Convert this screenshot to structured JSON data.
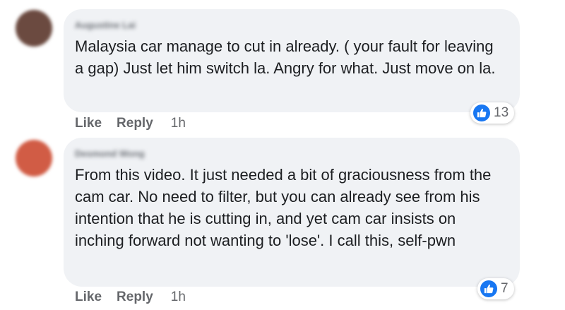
{
  "comments": [
    {
      "author": "Augustine Lai",
      "avatar_color": "#6b4a40",
      "text": "Malaysia car manage to cut in already. ( your fault for leaving a gap) Just let him switch la. Angry for what. Just move on la.",
      "like_label": "Like",
      "reply_label": "Reply",
      "time": "1h",
      "reaction_count": "13"
    },
    {
      "author": "Desmond Wong",
      "avatar_color": "#d15c45",
      "text": "From this video. It just needed a bit of graciousness from the cam car. No need to filter, but you can already see from his intention that he is cutting in, and yet cam car insists on inching forward not wanting to 'lose'. I call this, self-pwn",
      "like_label": "Like",
      "reply_label": "Reply",
      "time": "1h",
      "reaction_count": "7"
    }
  ],
  "colors": {
    "bubble_bg": "#f0f2f5",
    "like_blue": "#1877f2",
    "meta_gray": "#65676b"
  },
  "icons": {
    "reaction": "thumbs-up-icon"
  }
}
